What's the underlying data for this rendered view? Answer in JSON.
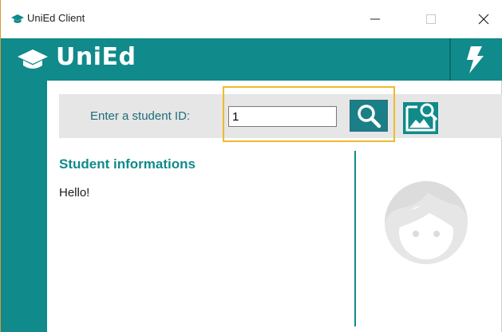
{
  "window": {
    "title": "UniEd Client",
    "icon": "graduation-cap-icon"
  },
  "header": {
    "brand": "UniEd",
    "logo_icon": "graduation-cap-icon",
    "action_icon": "lightning-bolt-icon"
  },
  "search": {
    "label": "Enter a student ID:",
    "value": "1",
    "search_icon": "magnifier-icon",
    "photo_icon": "image-search-icon"
  },
  "student": {
    "heading": "Student informations",
    "text": "Hello!",
    "avatar_icon": "avatar-face-icon"
  },
  "colors": {
    "accent": "#108a8a",
    "highlight": "#f0b92e",
    "panel": "#e6e6e6"
  }
}
